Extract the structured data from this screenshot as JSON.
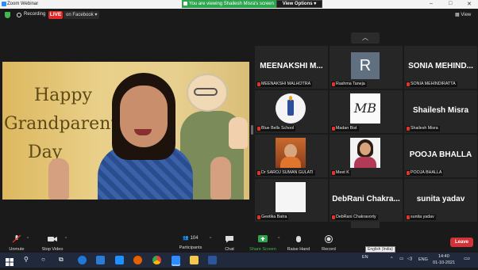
{
  "window": {
    "title": "Zoom Webinar",
    "controls": [
      "–",
      "□",
      "✕"
    ]
  },
  "topbar": {
    "recording_label": "Recording",
    "live_badge": "LIVE",
    "live_target": "on Facebook ▾",
    "share_banner": "You are viewing Shailesh Misra's screen",
    "view_options": "View Options ▾",
    "view_button": "View"
  },
  "main_video": {
    "line1": "Happy",
    "line2": "Grandparents",
    "line3": "Day"
  },
  "gallery": {
    "tiles": [
      {
        "display": "MEENAKSHI  M...",
        "label": "MEENAKSHI MALHOTRA",
        "kind": "text",
        "muted": true
      },
      {
        "display": "R",
        "label": "Rashma Taneja",
        "kind": "avatar",
        "muted": true
      },
      {
        "display": "SONIA  MEHIND...",
        "label": "SONIA MEHINDIRATTA",
        "kind": "text",
        "muted": true
      },
      {
        "display": "",
        "label": "Blue Bells School",
        "kind": "logo",
        "muted": true
      },
      {
        "display": "MB",
        "label": "Madan Bist",
        "kind": "mb",
        "muted": true
      },
      {
        "display": "Shailesh Misra",
        "label": "Shailesh Misra",
        "kind": "text",
        "muted": true
      },
      {
        "display": "",
        "label": "Dr SAROJ SUMAN GULATI",
        "kind": "photo1",
        "muted": true
      },
      {
        "display": "",
        "label": "Meet K",
        "kind": "photo2",
        "muted": true
      },
      {
        "display": "POOJA  BHALLA",
        "label": "POOJA BHALLA",
        "kind": "text",
        "muted": true
      },
      {
        "display": "",
        "label": "Geetika Batra",
        "kind": "blank",
        "muted": true
      },
      {
        "display": "DebRani  Chakra...",
        "label": "DebRani Chakravorty",
        "kind": "text",
        "muted": true
      },
      {
        "display": "sunita yadav",
        "label": "sunita yadav",
        "kind": "text",
        "muted": true
      }
    ]
  },
  "toolbar": {
    "unmute": "Unmute",
    "stop_video": "Stop Video",
    "participants": "Participants",
    "participant_count": "104",
    "chat": "Chat",
    "share_screen": "Share Screen",
    "raise_hand": "Raise Hand",
    "record": "Record",
    "leave": "Leave",
    "tooltip": "English (India)"
  },
  "taskbar": {
    "lang_short": "EN",
    "lang": "ENG",
    "time": "14:40",
    "date": "01-10-2021",
    "notif_count": "2"
  },
  "colors": {
    "accent_green": "#2da44e",
    "live_red": "#e02828",
    "leave_red": "#d13438"
  }
}
